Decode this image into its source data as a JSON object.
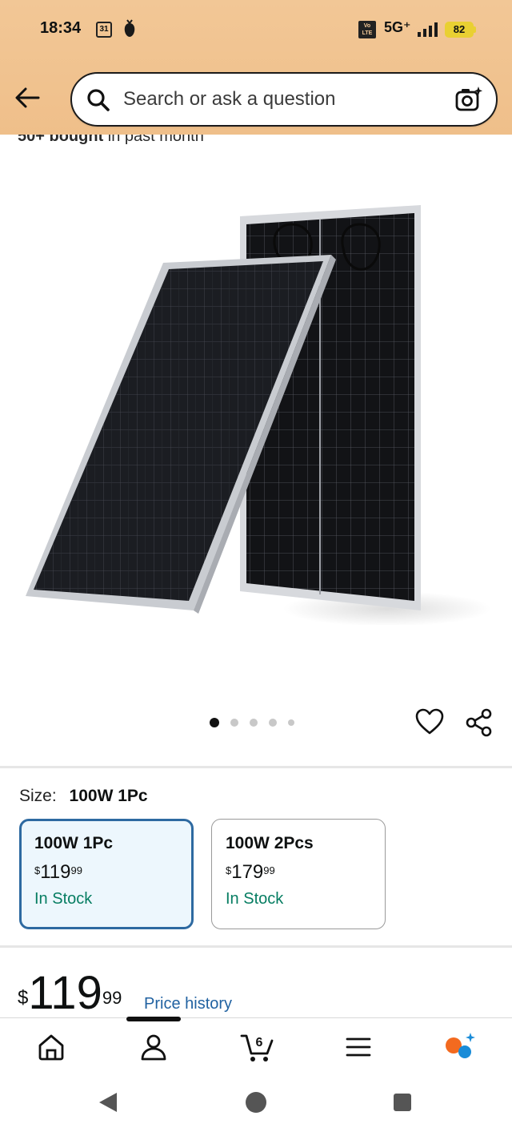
{
  "status_bar": {
    "time": "18:34",
    "calendar_day": "31",
    "volte_top": "Vo",
    "volte_bottom": "LTE",
    "network": "5G⁺",
    "battery": "82"
  },
  "search": {
    "placeholder": "Search or ask a question"
  },
  "product": {
    "bought_bold": "50+ bought",
    "bought_rest": " in past month",
    "carousel_count": 5,
    "carousel_active": 0
  },
  "size": {
    "label": "Size:",
    "selected": "100W 1Pc",
    "options": [
      {
        "name": "100W 1Pc",
        "price_cur": "$",
        "price_whole": "119",
        "price_cents": "99",
        "stock": "In Stock"
      },
      {
        "name": "100W 2Pcs",
        "price_cur": "$",
        "price_whole": "179",
        "price_cents": "99",
        "stock": "In Stock"
      }
    ]
  },
  "price": {
    "currency": "$",
    "whole": "119",
    "cents": "99",
    "history_link": "Price history"
  },
  "bottom_nav": {
    "cart_count": "6",
    "active_index": 1
  },
  "colors": {
    "header_bg": "#f2c796",
    "selected_border": "#2e6aa1",
    "selected_bg": "#edf7fd",
    "stock_green": "#067d62",
    "link_blue": "#2162a1"
  }
}
